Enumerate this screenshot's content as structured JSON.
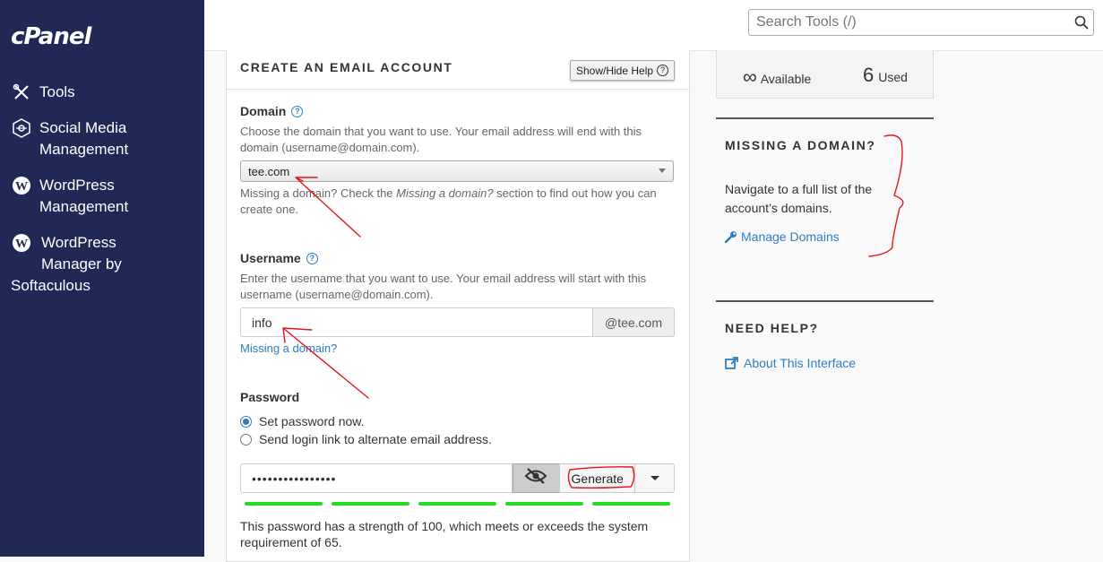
{
  "app": {
    "logo": "cPanel"
  },
  "sidebar": {
    "items": [
      {
        "label_lines": [
          "Tools"
        ],
        "icon": "tools-icon"
      },
      {
        "label_lines": [
          "Social Media",
          "Management"
        ],
        "icon": "social-media-icon"
      },
      {
        "label_lines": [
          "WordPress",
          "Management"
        ],
        "icon": "wordpress-icon"
      },
      {
        "label_lines": [
          "WordPress",
          "Manager by",
          "Softaculous"
        ],
        "icon": "wordpress-icon"
      }
    ]
  },
  "search": {
    "placeholder": "Search Tools (/)"
  },
  "form": {
    "title": "CREATE AN EMAIL ACCOUNT",
    "help_toggle": "Show/Hide Help",
    "domain": {
      "label": "Domain",
      "help": "Choose the domain that you want to use. Your email address will end with this domain (username@domain.com).",
      "value": "tee.com",
      "missing_pre": "Missing a domain? Check the ",
      "missing_em": "Missing a domain?",
      "missing_post": " section to find out how you can create one."
    },
    "username": {
      "label": "Username",
      "help": "Enter the username that you want to use. Your email address will start with this username (username@domain.com).",
      "value": "info",
      "suffix": "@tee.com",
      "missing_link": "Missing a domain?"
    },
    "password": {
      "label": "Password",
      "options": [
        "Set password now.",
        "Send login link to alternate email address."
      ],
      "selected": 0,
      "value": "••••••••••••••••",
      "generate": "Generate",
      "strength_segments": 5,
      "strength_text": "This password has a strength of 100, which meets or exceeds the system requirement of 65."
    }
  },
  "stats": {
    "available_symbol": "∞",
    "available_label": "Available",
    "used_count": "6",
    "used_label": "Used"
  },
  "missing_domain": {
    "title": "MISSING A DOMAIN?",
    "text": "Navigate to a full list of the account’s domains.",
    "link": "Manage Domains"
  },
  "need_help": {
    "title": "NEED HELP?",
    "link": "About This Interface"
  },
  "colors": {
    "sidebar": "#202856",
    "link": "#2f7dc1",
    "strength": "#22dd22",
    "annotation": "#e8141c"
  }
}
